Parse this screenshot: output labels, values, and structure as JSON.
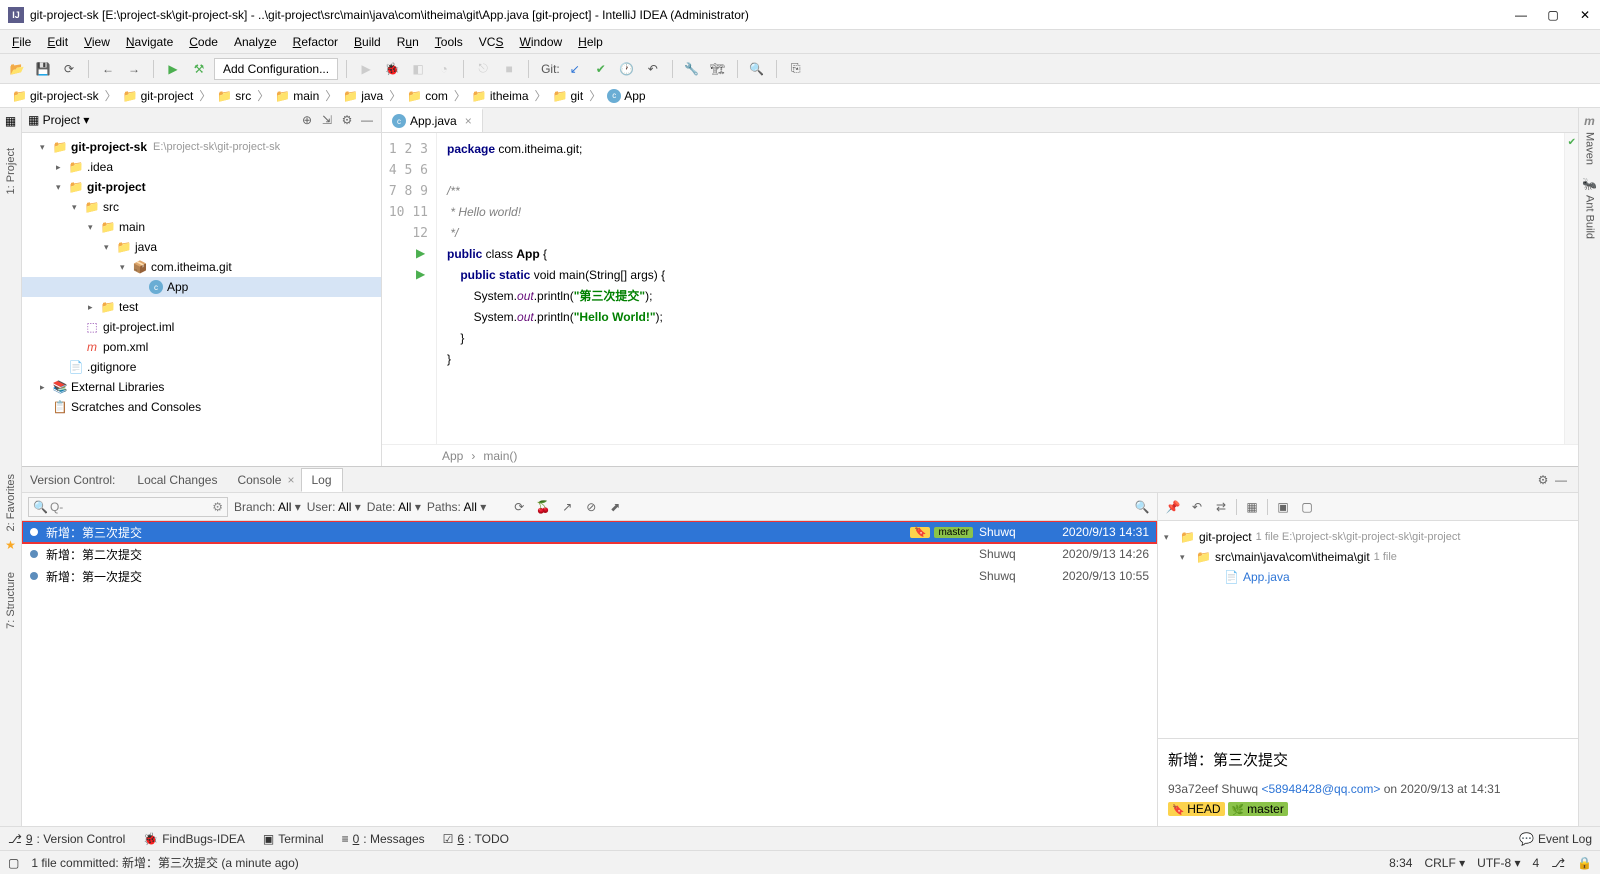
{
  "window": {
    "title": "git-project-sk [E:\\project-sk\\git-project-sk] - ..\\git-project\\src\\main\\java\\com\\itheima\\git\\App.java [git-project] - IntelliJ IDEA (Administrator)"
  },
  "menu": [
    "File",
    "Edit",
    "View",
    "Navigate",
    "Code",
    "Analyze",
    "Refactor",
    "Build",
    "Run",
    "Tools",
    "VCS",
    "Window",
    "Help"
  ],
  "toolbar": {
    "config": "Add Configuration...",
    "git_label": "Git:"
  },
  "breadcrumb": [
    "git-project-sk",
    "git-project",
    "src",
    "main",
    "java",
    "com",
    "itheima",
    "git",
    "App"
  ],
  "project": {
    "title": "Project",
    "root": {
      "name": "git-project-sk",
      "path": "E:\\project-sk\\git-project-sk"
    },
    "idea": ".idea",
    "module": "git-project",
    "src": "src",
    "main": "main",
    "java": "java",
    "pkg": "com.itheima.git",
    "app": "App",
    "test": "test",
    "iml": "git-project.iml",
    "pom": "pom.xml",
    "gitignore": ".gitignore",
    "ext": "External Libraries",
    "scratch": "Scratches and Consoles"
  },
  "editor": {
    "tab": "App.java",
    "crumb1": "App",
    "crumb2": "main()",
    "lines": {
      "l1a": "package",
      "l1b": " com.itheima.git;",
      "l3": "/**",
      "l4": " * Hello world!",
      "l5": " */",
      "l6a": "public",
      "l6b": " class ",
      "l6c": "App",
      "l6d": " {",
      "l7a": "    public static",
      "l7b": " void ",
      "l7c": "main",
      "l7d": "(String[] args) {",
      "l8a": "        System.",
      "l8b": "out",
      "l8c": ".println(",
      "l8d": "\"第三次提交\"",
      "l8e": ");",
      "l9a": "        System.",
      "l9b": "out",
      "l9c": ".println(",
      "l9d": "\"Hello World!\"",
      "l9e": ");",
      "l10": "    }",
      "l11": "}"
    }
  },
  "vcs": {
    "label": "Version Control:",
    "tabs": {
      "local": "Local Changes",
      "console": "Console",
      "log": "Log"
    },
    "filter": {
      "search_ph": "Q-",
      "branch": "Branch:",
      "branch_v": "All",
      "user": "User:",
      "user_v": "All",
      "date": "Date:",
      "date_v": "All",
      "paths": "Paths:",
      "paths_v": "All"
    },
    "log": [
      {
        "msg": "新增：第三次提交",
        "branch": "master",
        "author": "Shuwq",
        "date": "2020/9/13 14:31",
        "selected": true,
        "highlight": true,
        "tag": true
      },
      {
        "msg": "新增：第二次提交",
        "author": "Shuwq",
        "date": "2020/9/13 14:26"
      },
      {
        "msg": "新增：第一次提交",
        "author": "Shuwq",
        "date": "2020/9/13 10:55"
      }
    ],
    "files": {
      "root": "git-project",
      "root_meta": "1 file  E:\\project-sk\\git-project-sk\\git-project",
      "path": "src\\main\\java\\com\\itheima\\git",
      "path_meta": "1 file",
      "file": "App.java"
    },
    "detail": {
      "title": "新增：第三次提交",
      "hash": "93a72eef",
      "author": "Shuwq",
      "email": "<58948428@qq.com>",
      "on": "on 2020/9/13 at 14:31",
      "head": "HEAD",
      "master": "master"
    }
  },
  "bottom_tools": {
    "vc": "9: Version Control",
    "findbugs": "FindBugs-IDEA",
    "terminal": "Terminal",
    "messages": "0: Messages",
    "todo": "6: TODO",
    "eventlog": "Event Log"
  },
  "status": {
    "msg": "1 file committed: 新增：第三次提交 (a minute ago)",
    "pos": "8:34",
    "crlf": "CRLF",
    "enc": "UTF-8",
    "spaces": "4"
  },
  "side": {
    "project": "1: Project",
    "favorites": "2: Favorites",
    "structure": "7: Structure",
    "maven": "Maven",
    "ant": "Ant Build"
  }
}
